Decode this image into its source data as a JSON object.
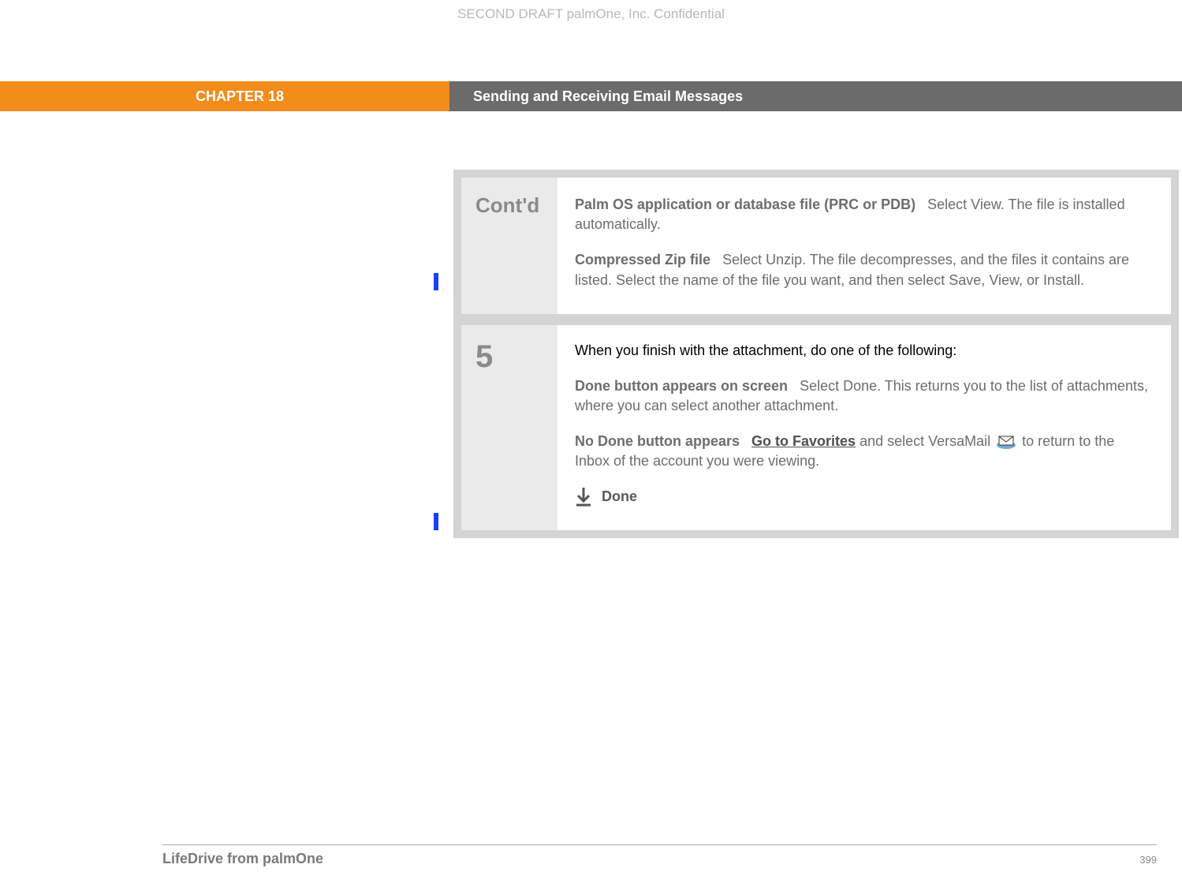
{
  "watermark": "SECOND DRAFT palmOne, Inc.  Confidential",
  "header": {
    "chapter": "CHAPTER 18",
    "title": "Sending and Receiving Email Messages"
  },
  "steps": [
    {
      "label": "Cont'd",
      "blocks": [
        {
          "lead": "Palm OS application or database file (PRC or PDB)",
          "text": "Select View. The file is installed automatically."
        },
        {
          "lead": "Compressed Zip file",
          "text": "Select Unzip. The file decompresses, and the files it contains are listed. Select the name of the file you want, and then select Save, View, or Install."
        }
      ]
    },
    {
      "label": "5",
      "intro": "When you finish with the attachment, do one of the following:",
      "blocks": [
        {
          "lead": "Done button appears on screen",
          "text": "Select Done. This returns you to the list of attachments, where you can select another attachment."
        },
        {
          "lead": "No Done button appears",
          "link": "Go to Favorites",
          "text_before_icon": " and select VersaMail ",
          "text_after_icon": " to return to the Inbox of the account you were viewing."
        }
      ],
      "done_label": "Done"
    }
  ],
  "footer": {
    "left": "LifeDrive from palmOne",
    "page": "399"
  }
}
